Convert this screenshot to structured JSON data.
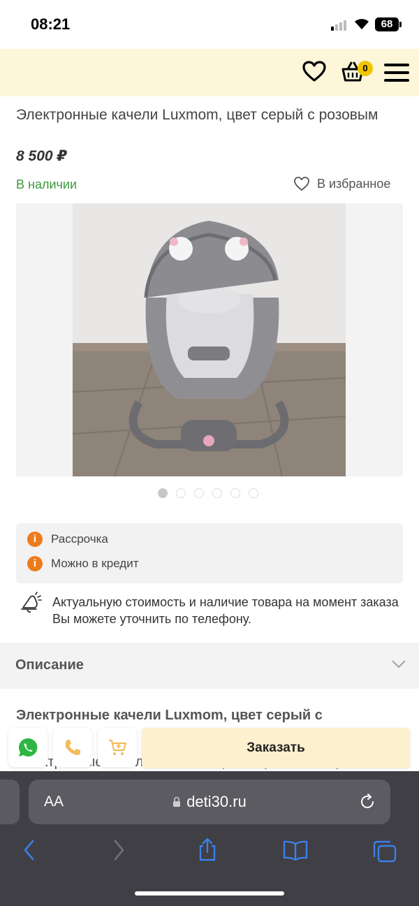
{
  "status_bar": {
    "time": "08:21",
    "battery": "68"
  },
  "header": {
    "cart_count": "0"
  },
  "product": {
    "title": "Электронные качели Luxmom, цвет серый с розовым",
    "price": "8 500 ₽",
    "stock": "В наличии",
    "favorite_label": "В избранное"
  },
  "gallery": {
    "image_count": 6,
    "active_index": 0
  },
  "info": {
    "items": [
      "Рассрочка",
      "Можно в кредит"
    ]
  },
  "notice": {
    "text": "Актуальную стоимость и наличие товара на момент заказа Вы можете уточнить по телефону."
  },
  "description": {
    "title": "Описание",
    "heading": "Электронные качели Luxmom, цвет серый с",
    "heading_cut": "р...",
    "body": "Электронные качели Luxmom, цвет серый. Электр"
  },
  "actions": {
    "order_label": "Заказать"
  },
  "browser": {
    "aa": "AA",
    "url": "deti30.ru"
  },
  "colors": {
    "accent": "#fdf6d8",
    "badge": "#f2c400",
    "in_stock": "#3c9a3c",
    "info_icon": "#ee7b1b",
    "browser_icons": "#3d7fe8"
  }
}
